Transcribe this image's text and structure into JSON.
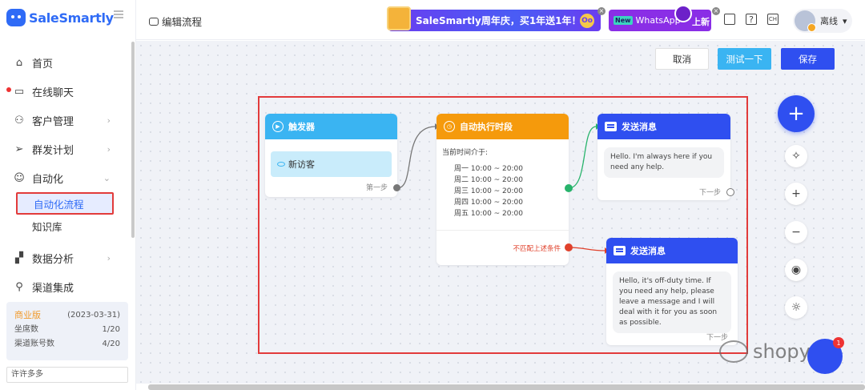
{
  "app": {
    "logo_text": "SaleSmartly"
  },
  "sidebar": {
    "items": [
      {
        "label": "首页",
        "icon": "home-icon"
      },
      {
        "label": "在线聊天",
        "icon": "chat-icon",
        "dot": true
      },
      {
        "label": "客户管理",
        "icon": "users-icon",
        "chevron": "›"
      },
      {
        "label": "群发计划",
        "icon": "send-icon",
        "chevron": "›"
      },
      {
        "label": "自动化",
        "icon": "robot-icon",
        "chevron": "⌄"
      },
      {
        "label": "数据分析",
        "icon": "chart-icon",
        "chevron": "›"
      },
      {
        "label": "渠道集成",
        "icon": "network-icon"
      }
    ],
    "sub_items": {
      "flow": "自动化流程",
      "kb": "知识库"
    },
    "plan": {
      "name": "商业版",
      "date": "(2023-03-31)",
      "seats_label": "坐席数",
      "seats_value": "1/20",
      "channels_label": "渠道账号数",
      "channels_value": "4/20"
    },
    "search_value": "许许多多"
  },
  "header": {
    "page_title": "编辑流程",
    "promo_text": "SaleSmartly周年庆，买1年送1年！",
    "promo_badge": "Oo",
    "wa_new": "New",
    "wa_text": "WhatsApp",
    "wa_new_label": "上新",
    "user_status": "离线",
    "user_caret": "▾"
  },
  "toolbar": {
    "cancel": "取消",
    "test": "测试一下",
    "save": "保存"
  },
  "nodes": {
    "trigger": {
      "title": "触发器",
      "tag": "新访客",
      "next": "第一步"
    },
    "time": {
      "title": "自动执行时段",
      "subtitle": "当前时间介于:",
      "rows": [
        "周一 10:00 ~ 20:00",
        "周二 10:00 ~ 20:00",
        "周三 10:00 ~ 20:00",
        "周四 10:00 ~ 20:00",
        "周五 10:00 ~ 20:00"
      ],
      "nomatch": "不匹配上述条件"
    },
    "msg1": {
      "title": "发送消息",
      "text": "Hello. I'm always here if you need any help.",
      "next": "下一步"
    },
    "msg2": {
      "title": "发送消息",
      "text": "Hello, it's off-duty time. If you need any help, please leave a message and I will deal with it for you as soon as possible.",
      "next": "下一步"
    }
  },
  "watermark": {
    "text": "shopyy"
  },
  "chat_fab_badge": "1",
  "colors": {
    "primary": "#2f4ff0",
    "trigger": "#3ab4f2",
    "time": "#f59a0c",
    "highlight": "#e23b3b",
    "connector_ok": "#27b36b",
    "connector_fail": "#e0412b"
  }
}
